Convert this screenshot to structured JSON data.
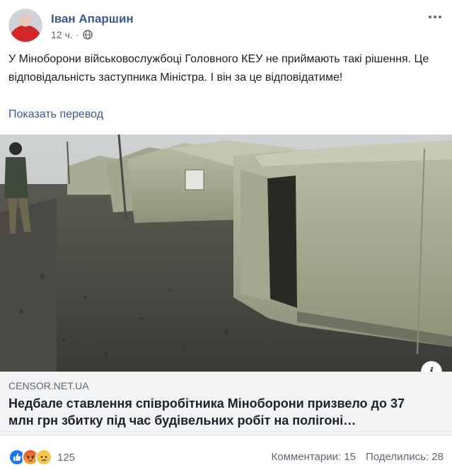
{
  "post": {
    "author": "Іван Апаршин",
    "time": "12 ч.",
    "text": "У Міноборони військовослужбоці Головного КЕУ не приймають такі рішення. Це відповідальність заступника Міністра. І він за це відповідатиме!",
    "translate_label": "Показать перевод"
  },
  "link_preview": {
    "domain": "CENSOR.NET.UA",
    "title": "Недбале ставлення співробітника Міноборони призвело до 37 млн грн збитку під час будівельних робіт на полігоні…"
  },
  "footer": {
    "reactions": [
      "like-icon",
      "angry-icon",
      "sad-icon"
    ],
    "reaction_count": "125",
    "comments": "Комментарии: 15",
    "shares": "Поделились: 28"
  },
  "colors": {
    "link_blue": "#385898",
    "meta_gray": "#606770",
    "preview_bg": "#f2f3f5"
  }
}
